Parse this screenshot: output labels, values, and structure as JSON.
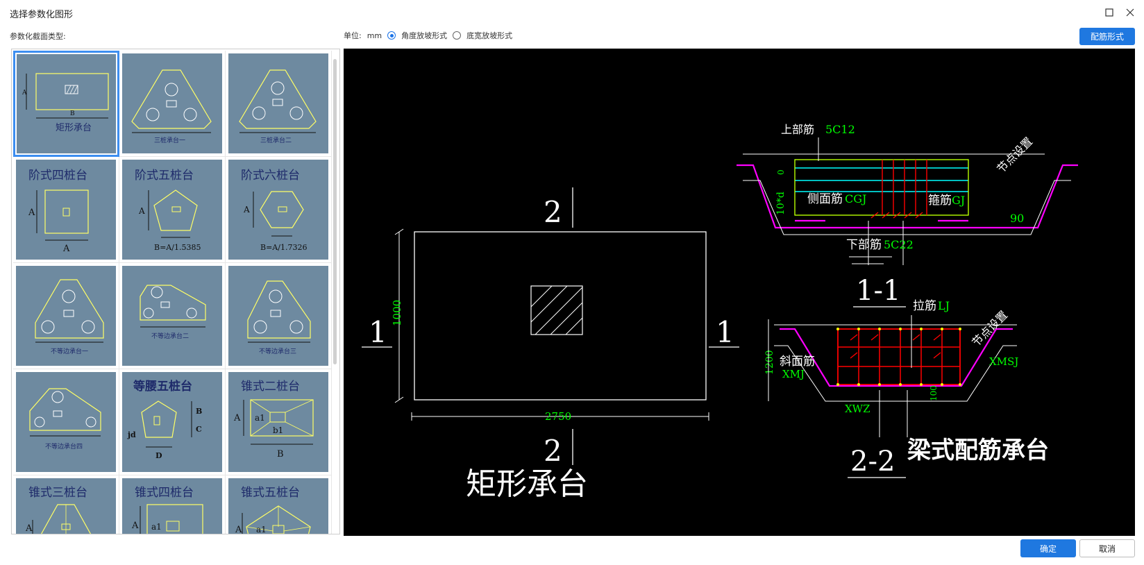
{
  "window": {
    "title": "选择参数化图形",
    "maximize_icon": "maximize-icon",
    "close_icon": "close-icon"
  },
  "left_label": "参数化截面类型:",
  "unit": {
    "label": "单位:",
    "value": "mm",
    "option_angle": "角度放坡形式",
    "option_width": "底宽放坡形式",
    "selected": "angle"
  },
  "buttons": {
    "rebar_form": "配筋形式",
    "ok": "确定",
    "cancel": "取消"
  },
  "colors": {
    "accent": "#1f78e0",
    "thumb_bg": "#6e8aa0",
    "selection": "#3d8ef0",
    "cad_bg": "#000000",
    "cad_green": "#00ff00",
    "cad_magenta": "#ff00ff",
    "cad_red": "#ff0000",
    "cad_cyan": "#00ffff",
    "cad_yellow": "#ffff00"
  },
  "shapes": [
    {
      "label": "矩形承台",
      "B": "B",
      "A": "A"
    },
    {
      "label": "三桩承台一"
    },
    {
      "label": "三桩承台二"
    },
    {
      "label": "阶式四桩台",
      "A": "A",
      "B": "A"
    },
    {
      "label": "阶式五桩台",
      "A": "A",
      "B": "B=A/1.5385"
    },
    {
      "label": "阶式六桩台",
      "A": "A",
      "B": "B=A/1.7326"
    },
    {
      "label": "不等边承台一"
    },
    {
      "label": "不等边承台二"
    },
    {
      "label": "不等边承台三"
    },
    {
      "label": "不等边承台四"
    },
    {
      "label": "等腰五桩台",
      "B": "B",
      "C": "C",
      "D": "D",
      "jd": "jd"
    },
    {
      "label": "锥式二桩台",
      "A": "A",
      "a1": "a1",
      "b1": "b1",
      "B": "B"
    },
    {
      "label": "锥式三桩台",
      "A": "A"
    },
    {
      "label": "锥式四桩台",
      "A": "A",
      "a1": "a1"
    },
    {
      "label": "锥式五桩台",
      "A": "A",
      "a1": "a1"
    }
  ],
  "preview": {
    "main_title": "矩形承台",
    "section_2_top": "2",
    "section_2_bottom": "2",
    "section_1_left": "1",
    "section_1_right": "1",
    "dim_width": "2750",
    "dim_height": "1000",
    "section_11": {
      "title": "1-1",
      "top_rebar_label": "上部筋",
      "top_rebar_value": "5C12",
      "side_rebar_label": "侧面筋",
      "side_rebar_value": "CGJ",
      "stirrup_label": "箍筋",
      "stirrup_value": "GJ",
      "bottom_rebar_label": "下部筋",
      "bottom_rebar_value": "5C22",
      "node_label": "节点设置",
      "angle": "90",
      "dim_left": "10*d",
      "dim_zero": "0"
    },
    "section_22": {
      "title": "2-2",
      "tie_label": "拉筋",
      "tie_value": "LJ",
      "slope_label": "斜面筋",
      "slope_value": "XMJ",
      "xmsj": "XMSJ",
      "xwz": "XWZ",
      "node_label": "节点设置",
      "dim_height": "1200",
      "dim_100": "100"
    },
    "beam_title": "梁式配筋承台"
  }
}
